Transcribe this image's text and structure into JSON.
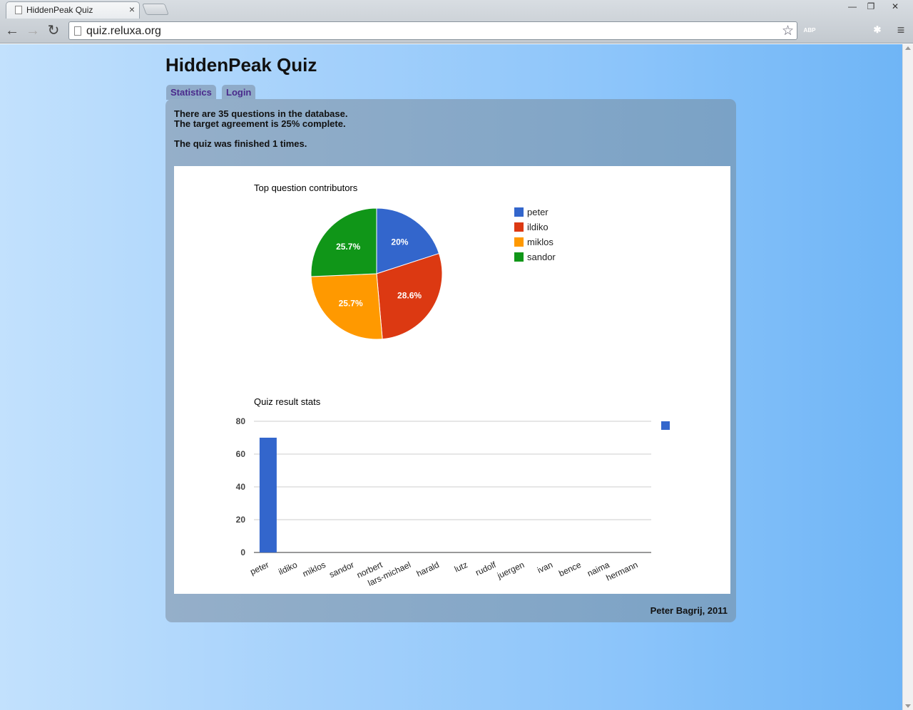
{
  "browser": {
    "tab_title": "HiddenPeak Quiz",
    "tab_close": "×",
    "url": "quiz.reluxa.org",
    "window_controls": [
      "—",
      "❐",
      "✕"
    ],
    "extensions": [
      {
        "name": "adblock-icon",
        "label": "ABP",
        "color": "#c0392b"
      },
      {
        "name": "sync-icon",
        "label": "",
        "color": "#1f3e9e"
      },
      {
        "name": "bookmark-icon",
        "label": "",
        "color": "#c0392b"
      },
      {
        "name": "lastpass-icon",
        "label": "✱",
        "color": "#c9282d"
      }
    ]
  },
  "page": {
    "title": "HiddenPeak Quiz",
    "tabs": [
      "Statistics",
      "Login"
    ],
    "stats": {
      "questions": "There are 35 questions in the database.",
      "agreement": "The target agreement is 25% complete.",
      "finished": "The quiz was finished 1 times."
    },
    "footer": "Peter Bagrij, 2011"
  },
  "chart_data": [
    {
      "type": "pie",
      "title": "Top question contributors",
      "slices": [
        {
          "name": "peter",
          "value": 20,
          "label": "20%",
          "color": "#3366cc"
        },
        {
          "name": "ildiko",
          "value": 28.6,
          "label": "28.6%",
          "color": "#dc3912"
        },
        {
          "name": "miklos",
          "value": 25.7,
          "label": "25.7%",
          "color": "#ff9900"
        },
        {
          "name": "sandor",
          "value": 25.7,
          "label": "25.7%",
          "color": "#109618"
        }
      ],
      "legend": "right"
    },
    {
      "type": "bar",
      "title": "Quiz result stats",
      "categories": [
        "peter",
        "ildiko",
        "miklos",
        "sandor",
        "norbert",
        "lars-michael",
        "harald",
        "lutz",
        "rudolf",
        "juergen",
        "ivan",
        "bence",
        "naima",
        "hermann"
      ],
      "values": [
        70,
        0,
        0,
        0,
        0,
        0,
        0,
        0,
        0,
        0,
        0,
        0,
        0,
        0
      ],
      "color": "#3366cc",
      "ylim": [
        0,
        80
      ],
      "yticks": [
        "0",
        "20",
        "40",
        "60",
        "80"
      ],
      "grid": true,
      "legend": "right"
    }
  ]
}
